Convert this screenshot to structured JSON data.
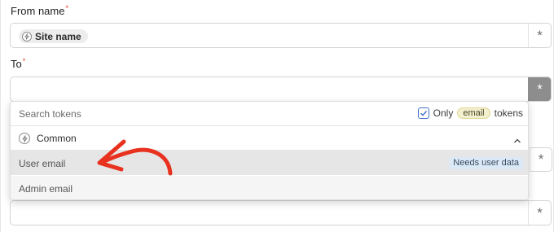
{
  "from_name": {
    "label": "From name",
    "required_mark": "*",
    "chip_label": "Site name",
    "token_button": "*"
  },
  "to": {
    "label": "To",
    "required_mark": "*",
    "token_button": "*"
  },
  "hidden_field_buttons": [
    "*",
    "*"
  ],
  "token_dropdown": {
    "search_placeholder": "Search tokens",
    "only_prefix": "Only",
    "only_filter_pill": "email",
    "only_suffix": "tokens",
    "only_checked": true,
    "group_label": "Common",
    "items": [
      {
        "label": "User email",
        "badge": "Needs user data"
      },
      {
        "label": "Admin email"
      }
    ]
  },
  "colors": {
    "required": "#e0392b",
    "active_token_button": "#8d8d8d",
    "annotation_arrow": "#e8311f",
    "badge_bg": "#dbe9f7",
    "email_pill_bg": "#f3efcf"
  }
}
